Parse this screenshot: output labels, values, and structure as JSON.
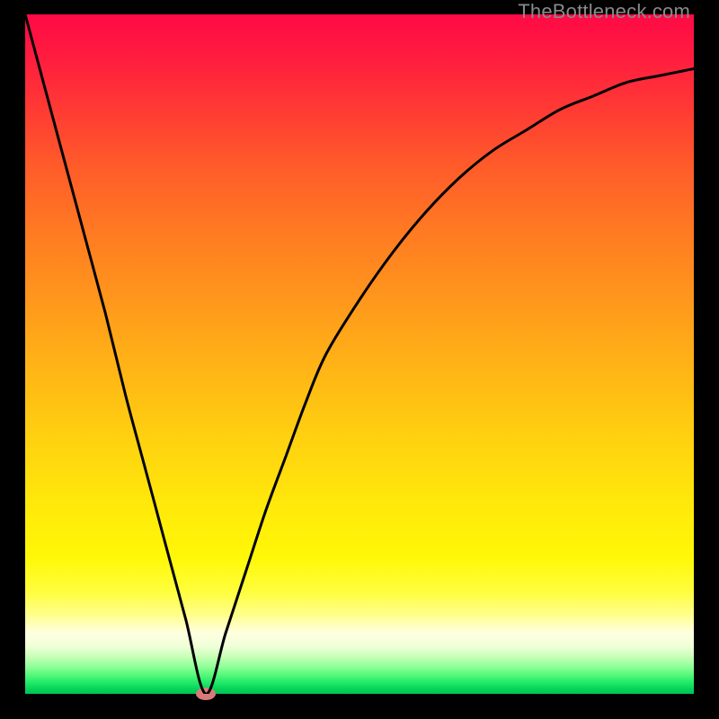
{
  "watermark": "TheBottleneck.com",
  "colors": {
    "frame": "#000000",
    "curve": "#000000",
    "marker": "#d97a7a",
    "watermark_text": "#8a8a8a"
  },
  "chart_data": {
    "type": "line",
    "title": "",
    "xlabel": "",
    "ylabel": "",
    "xlim": [
      0,
      100
    ],
    "ylim": [
      0,
      100
    ],
    "grid": false,
    "legend": false,
    "background": "gradient red-to-green (vertical)",
    "marker": {
      "x": 27,
      "y": 0,
      "shape": "capsule",
      "color": "#d97a7a"
    },
    "series": [
      {
        "name": "bottleneck-curve",
        "color": "#000000",
        "x": [
          0,
          3,
          6,
          9,
          12,
          15,
          18,
          21,
          24,
          27,
          30,
          33,
          36,
          39,
          42,
          45,
          50,
          55,
          60,
          65,
          70,
          75,
          80,
          85,
          90,
          95,
          100
        ],
        "y": [
          100,
          89,
          78,
          67,
          56,
          44,
          33,
          22,
          11,
          0,
          9,
          18,
          27,
          35,
          43,
          50,
          58,
          65,
          71,
          76,
          80,
          83,
          86,
          88,
          90,
          91,
          92
        ]
      }
    ]
  }
}
